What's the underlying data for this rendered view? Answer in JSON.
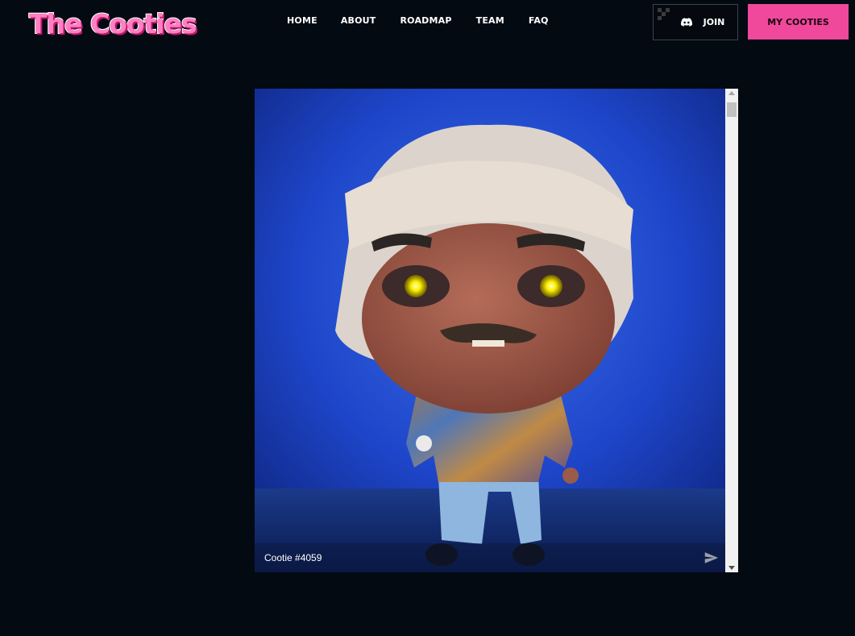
{
  "header": {
    "logo_text": "The Cooties",
    "nav": [
      "HOME",
      "ABOUT",
      "ROADMAP",
      "TEAM",
      "FAQ"
    ],
    "join_label": "JOIN",
    "my_cooties_label": "MY COOTIES"
  },
  "viewer": {
    "caption": "Cootie #4059"
  },
  "colors": {
    "background": "#040a12",
    "accent": "#f0489b"
  }
}
